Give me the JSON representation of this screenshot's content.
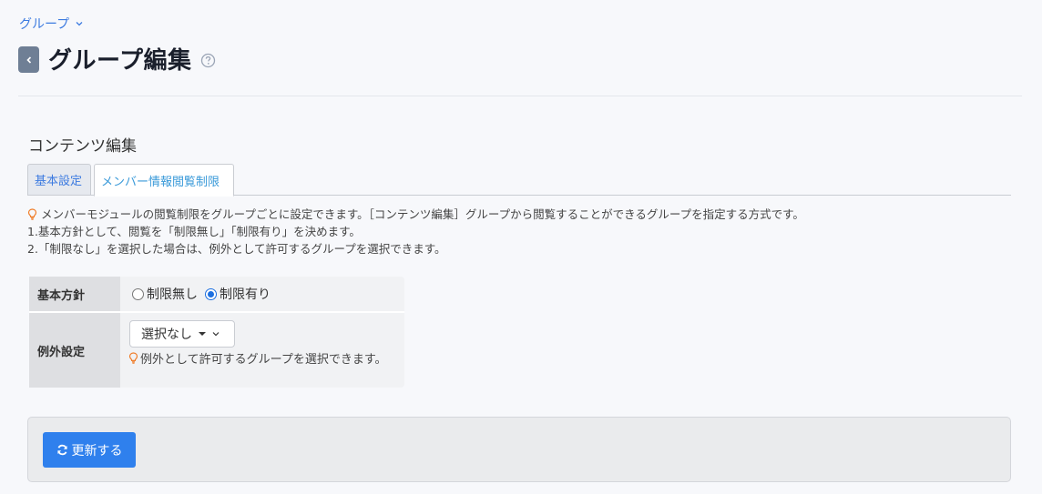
{
  "breadcrumb": {
    "label": "グループ"
  },
  "header": {
    "title": "グループ編集"
  },
  "section": {
    "title": "コンテンツ編集"
  },
  "tabs": [
    {
      "label": "基本設定",
      "active": false
    },
    {
      "label": "メンバー情報閲覧制限",
      "active": true
    }
  ],
  "notes": [
    "メンバーモジュールの閲覧制限をグループごとに設定できます。［コンテンツ編集］グループから閲覧することができるグループを指定する方式です。",
    "1.基本方針として、閲覧を「制限無し」「制限有り」を決めます。",
    "2.「制限なし」を選択した場合は、例外として許可するグループを選択できます。"
  ],
  "settings": {
    "policy_label": "基本方針",
    "options": [
      {
        "label": "制限無し",
        "checked": false
      },
      {
        "label": "制限有り",
        "checked": true
      }
    ],
    "exception_label": "例外設定",
    "exception_select": "選択なし",
    "exception_note": "例外として許可するグループを選択できます。"
  },
  "footer": {
    "update_label": "更新する"
  },
  "colors": {
    "accent": "#2f80ed",
    "link": "#3d7be0",
    "hint": "#f07c28"
  },
  "icons": [
    "chevron-down-icon",
    "back-arrow-icon",
    "help-icon",
    "lightbulb-icon",
    "refresh-icon"
  ]
}
